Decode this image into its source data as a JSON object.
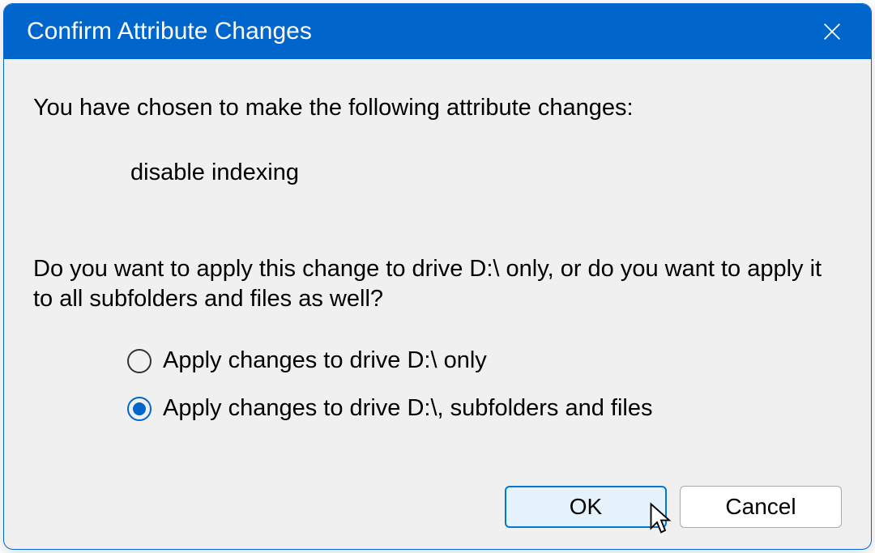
{
  "dialog": {
    "title": "Confirm Attribute Changes",
    "intro": "You have chosen to make the following attribute changes:",
    "change": "disable indexing",
    "question": "Do you want to apply this change to drive D:\\ only, or do you want to apply it to all subfolders and files as well?",
    "options": {
      "drive_only": "Apply changes to drive D:\\ only",
      "all": "Apply changes to drive D:\\, subfolders and files"
    },
    "selected": "all",
    "buttons": {
      "ok": "OK",
      "cancel": "Cancel"
    }
  }
}
